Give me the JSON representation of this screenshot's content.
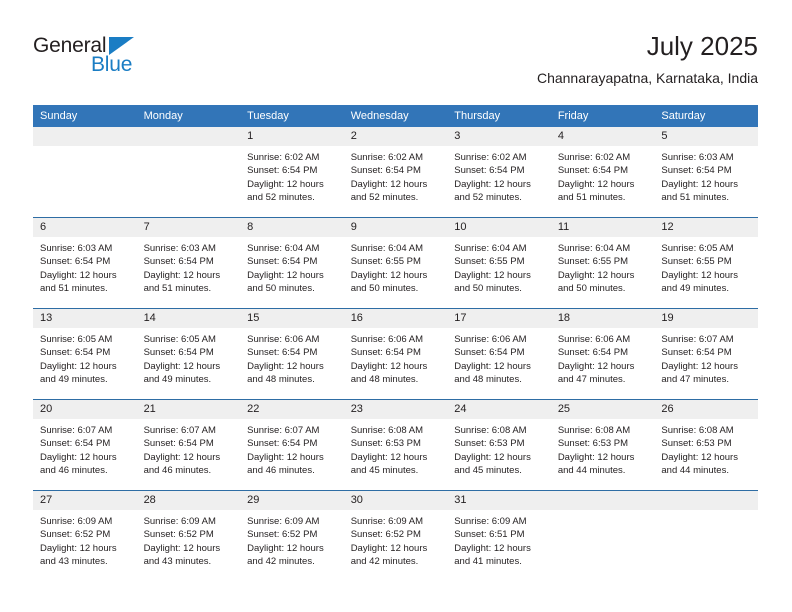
{
  "brand": {
    "name_line1": "General",
    "name_line2": "Blue",
    "accent_color": "#1a7dc4"
  },
  "header": {
    "month_title": "July 2025",
    "location": "Channarayapatna, Karnataka, India"
  },
  "theme": {
    "header_blue": "#3275b8",
    "row_divider_blue": "#2e6da4",
    "daynum_band": "#efefef"
  },
  "columns": [
    "Sunday",
    "Monday",
    "Tuesday",
    "Wednesday",
    "Thursday",
    "Friday",
    "Saturday"
  ],
  "weeks": [
    [
      {
        "day": "",
        "sunrise": "",
        "sunset": "",
        "daylight": "",
        "empty": true
      },
      {
        "day": "",
        "sunrise": "",
        "sunset": "",
        "daylight": "",
        "empty": true
      },
      {
        "day": "1",
        "sunrise": "Sunrise: 6:02 AM",
        "sunset": "Sunset: 6:54 PM",
        "daylight": "Daylight: 12 hours and 52 minutes."
      },
      {
        "day": "2",
        "sunrise": "Sunrise: 6:02 AM",
        "sunset": "Sunset: 6:54 PM",
        "daylight": "Daylight: 12 hours and 52 minutes."
      },
      {
        "day": "3",
        "sunrise": "Sunrise: 6:02 AM",
        "sunset": "Sunset: 6:54 PM",
        "daylight": "Daylight: 12 hours and 52 minutes."
      },
      {
        "day": "4",
        "sunrise": "Sunrise: 6:02 AM",
        "sunset": "Sunset: 6:54 PM",
        "daylight": "Daylight: 12 hours and 51 minutes."
      },
      {
        "day": "5",
        "sunrise": "Sunrise: 6:03 AM",
        "sunset": "Sunset: 6:54 PM",
        "daylight": "Daylight: 12 hours and 51 minutes."
      }
    ],
    [
      {
        "day": "6",
        "sunrise": "Sunrise: 6:03 AM",
        "sunset": "Sunset: 6:54 PM",
        "daylight": "Daylight: 12 hours and 51 minutes."
      },
      {
        "day": "7",
        "sunrise": "Sunrise: 6:03 AM",
        "sunset": "Sunset: 6:54 PM",
        "daylight": "Daylight: 12 hours and 51 minutes."
      },
      {
        "day": "8",
        "sunrise": "Sunrise: 6:04 AM",
        "sunset": "Sunset: 6:54 PM",
        "daylight": "Daylight: 12 hours and 50 minutes."
      },
      {
        "day": "9",
        "sunrise": "Sunrise: 6:04 AM",
        "sunset": "Sunset: 6:55 PM",
        "daylight": "Daylight: 12 hours and 50 minutes."
      },
      {
        "day": "10",
        "sunrise": "Sunrise: 6:04 AM",
        "sunset": "Sunset: 6:55 PM",
        "daylight": "Daylight: 12 hours and 50 minutes."
      },
      {
        "day": "11",
        "sunrise": "Sunrise: 6:04 AM",
        "sunset": "Sunset: 6:55 PM",
        "daylight": "Daylight: 12 hours and 50 minutes."
      },
      {
        "day": "12",
        "sunrise": "Sunrise: 6:05 AM",
        "sunset": "Sunset: 6:55 PM",
        "daylight": "Daylight: 12 hours and 49 minutes."
      }
    ],
    [
      {
        "day": "13",
        "sunrise": "Sunrise: 6:05 AM",
        "sunset": "Sunset: 6:54 PM",
        "daylight": "Daylight: 12 hours and 49 minutes."
      },
      {
        "day": "14",
        "sunrise": "Sunrise: 6:05 AM",
        "sunset": "Sunset: 6:54 PM",
        "daylight": "Daylight: 12 hours and 49 minutes."
      },
      {
        "day": "15",
        "sunrise": "Sunrise: 6:06 AM",
        "sunset": "Sunset: 6:54 PM",
        "daylight": "Daylight: 12 hours and 48 minutes."
      },
      {
        "day": "16",
        "sunrise": "Sunrise: 6:06 AM",
        "sunset": "Sunset: 6:54 PM",
        "daylight": "Daylight: 12 hours and 48 minutes."
      },
      {
        "day": "17",
        "sunrise": "Sunrise: 6:06 AM",
        "sunset": "Sunset: 6:54 PM",
        "daylight": "Daylight: 12 hours and 48 minutes."
      },
      {
        "day": "18",
        "sunrise": "Sunrise: 6:06 AM",
        "sunset": "Sunset: 6:54 PM",
        "daylight": "Daylight: 12 hours and 47 minutes."
      },
      {
        "day": "19",
        "sunrise": "Sunrise: 6:07 AM",
        "sunset": "Sunset: 6:54 PM",
        "daylight": "Daylight: 12 hours and 47 minutes."
      }
    ],
    [
      {
        "day": "20",
        "sunrise": "Sunrise: 6:07 AM",
        "sunset": "Sunset: 6:54 PM",
        "daylight": "Daylight: 12 hours and 46 minutes."
      },
      {
        "day": "21",
        "sunrise": "Sunrise: 6:07 AM",
        "sunset": "Sunset: 6:54 PM",
        "daylight": "Daylight: 12 hours and 46 minutes."
      },
      {
        "day": "22",
        "sunrise": "Sunrise: 6:07 AM",
        "sunset": "Sunset: 6:54 PM",
        "daylight": "Daylight: 12 hours and 46 minutes."
      },
      {
        "day": "23",
        "sunrise": "Sunrise: 6:08 AM",
        "sunset": "Sunset: 6:53 PM",
        "daylight": "Daylight: 12 hours and 45 minutes."
      },
      {
        "day": "24",
        "sunrise": "Sunrise: 6:08 AM",
        "sunset": "Sunset: 6:53 PM",
        "daylight": "Daylight: 12 hours and 45 minutes."
      },
      {
        "day": "25",
        "sunrise": "Sunrise: 6:08 AM",
        "sunset": "Sunset: 6:53 PM",
        "daylight": "Daylight: 12 hours and 44 minutes."
      },
      {
        "day": "26",
        "sunrise": "Sunrise: 6:08 AM",
        "sunset": "Sunset: 6:53 PM",
        "daylight": "Daylight: 12 hours and 44 minutes."
      }
    ],
    [
      {
        "day": "27",
        "sunrise": "Sunrise: 6:09 AM",
        "sunset": "Sunset: 6:52 PM",
        "daylight": "Daylight: 12 hours and 43 minutes."
      },
      {
        "day": "28",
        "sunrise": "Sunrise: 6:09 AM",
        "sunset": "Sunset: 6:52 PM",
        "daylight": "Daylight: 12 hours and 43 minutes."
      },
      {
        "day": "29",
        "sunrise": "Sunrise: 6:09 AM",
        "sunset": "Sunset: 6:52 PM",
        "daylight": "Daylight: 12 hours and 42 minutes."
      },
      {
        "day": "30",
        "sunrise": "Sunrise: 6:09 AM",
        "sunset": "Sunset: 6:52 PM",
        "daylight": "Daylight: 12 hours and 42 minutes."
      },
      {
        "day": "31",
        "sunrise": "Sunrise: 6:09 AM",
        "sunset": "Sunset: 6:51 PM",
        "daylight": "Daylight: 12 hours and 41 minutes."
      },
      {
        "day": "",
        "sunrise": "",
        "sunset": "",
        "daylight": "",
        "empty": true
      },
      {
        "day": "",
        "sunrise": "",
        "sunset": "",
        "daylight": "",
        "empty": true
      }
    ]
  ]
}
